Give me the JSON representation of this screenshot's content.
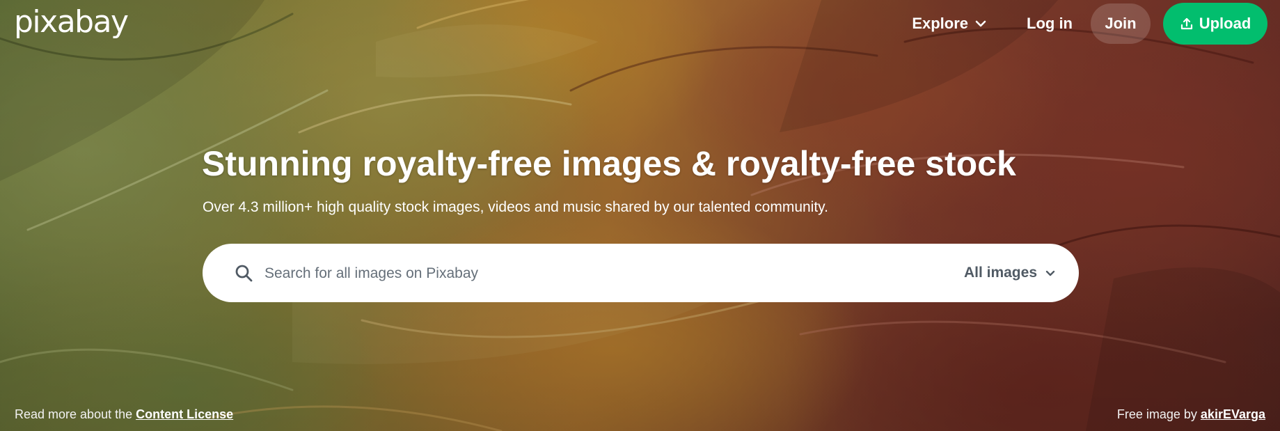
{
  "brand": {
    "logo_text": "pixabay"
  },
  "nav": {
    "explore_label": "Explore",
    "login_label": "Log in",
    "join_label": "Join",
    "upload_label": "Upload",
    "upload_color": "#02be6e"
  },
  "hero": {
    "title": "Stunning royalty-free images & royalty-free stock",
    "subtitle": "Over 4.3 million+ high quality stock images, videos and music shared by our talented community."
  },
  "search": {
    "placeholder": "Search for all images on Pixabay",
    "value": "",
    "type_selected": "All images"
  },
  "footer": {
    "license_prefix": "Read more about the",
    "license_link": "Content License",
    "credit_prefix": "Free image by",
    "credit_link": "akirEVarga"
  },
  "icons": {
    "explore_chevron": "chevron-down-icon",
    "upload": "upload-icon",
    "search": "search-icon",
    "type_chevron": "chevron-down-icon"
  }
}
